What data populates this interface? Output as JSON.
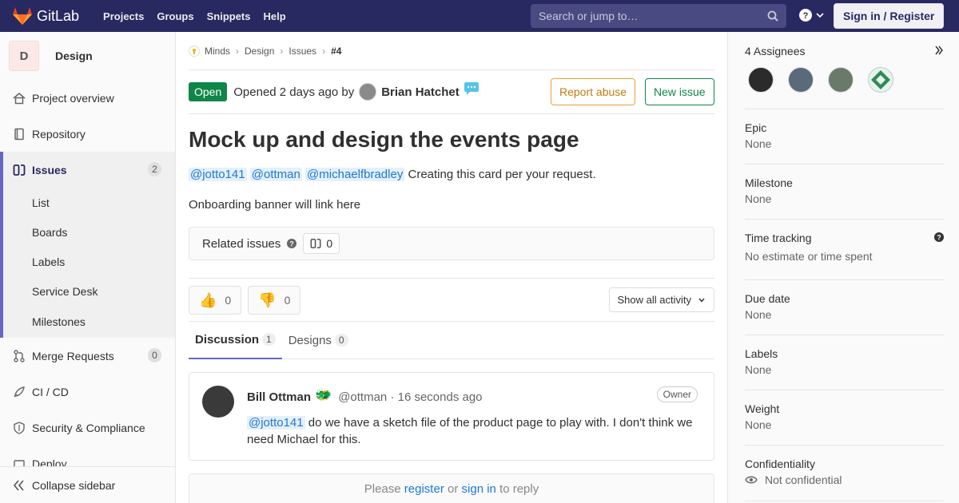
{
  "navbar": {
    "brand": "GitLab",
    "links": [
      "Projects",
      "Groups",
      "Snippets",
      "Help"
    ],
    "search_placeholder": "Search or jump to…",
    "signin": "Sign in / Register"
  },
  "sidebar": {
    "project_initial": "D",
    "project_name": "Design",
    "items": [
      {
        "label": "Project overview"
      },
      {
        "label": "Repository"
      },
      {
        "label": "Issues",
        "count": "2"
      },
      {
        "label": "Merge Requests",
        "count": "0"
      },
      {
        "label": "CI / CD"
      },
      {
        "label": "Security & Compliance"
      },
      {
        "label": "Deploy"
      }
    ],
    "issue_sub": [
      "List",
      "Boards",
      "Labels",
      "Service Desk",
      "Milestones"
    ],
    "collapse": "Collapse sidebar"
  },
  "breadcrumb": [
    "Minds",
    "Design",
    "Issues",
    "#4"
  ],
  "issue": {
    "status": "Open",
    "opened_text": "Opened 2 days ago by",
    "author": "Brian Hatchet",
    "report_abuse": "Report abuse",
    "new_issue": "New issue",
    "title": "Mock up and design the events page",
    "mentions": [
      "@jotto141",
      "@ottman",
      "@michaelfbradley"
    ],
    "desc_line1_rest": " Creating this card per your request.",
    "desc_line2": "Onboarding banner will link here",
    "related_label": "Related issues",
    "related_count": "0",
    "thumbs_up": "0",
    "thumbs_down": "0",
    "activity_filter": "Show all activity"
  },
  "tabs": [
    {
      "label": "Discussion",
      "count": "1"
    },
    {
      "label": "Designs",
      "count": "0"
    }
  ],
  "note": {
    "author": "Bill Ottman",
    "meta": "@ottman · 16 seconds ago",
    "role": "Owner",
    "mention": "@jotto141",
    "body": " do we have a sketch file of the product page to play with. I don't think we need Michael for this."
  },
  "reply": {
    "prefix": "Please",
    "register": "register",
    "or": "or",
    "signin": "sign in",
    "suffix": "to reply"
  },
  "right": {
    "assignees": "4 Assignees",
    "epic": {
      "title": "Epic",
      "value": "None"
    },
    "milestone": {
      "title": "Milestone",
      "value": "None"
    },
    "time_tracking": {
      "title": "Time tracking",
      "value": "No estimate or time spent"
    },
    "due_date": {
      "title": "Due date",
      "value": "None"
    },
    "labels": {
      "title": "Labels",
      "value": "None"
    },
    "weight": {
      "title": "Weight",
      "value": "None"
    },
    "confidentiality": {
      "title": "Confidentiality",
      "value": "Not confidential"
    }
  },
  "colors": {
    "navbar": "#292961",
    "open": "#108548",
    "accent": "#6666c4",
    "link": "#1f78d1"
  }
}
